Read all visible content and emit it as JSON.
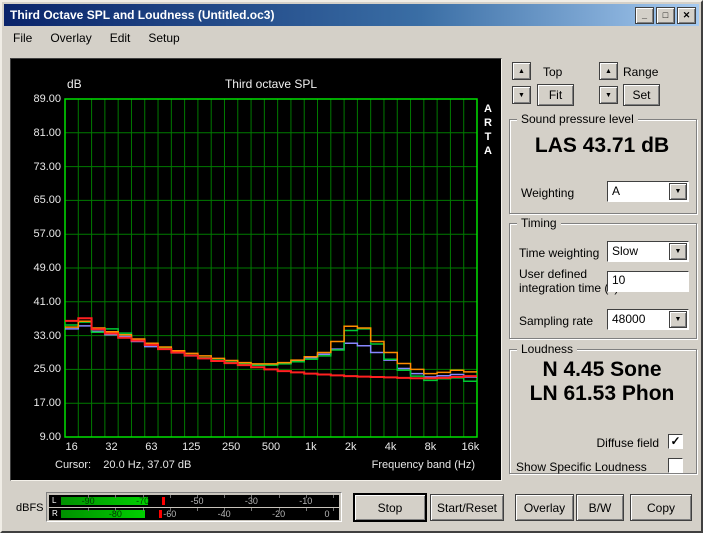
{
  "window": {
    "title": "Third Octave SPL and Loudness (Untitled.oc3)"
  },
  "icons": {
    "up": "▲",
    "down": "▼",
    "dropdown": "▼",
    "check": "✓",
    "minimize": "_",
    "maximize": "□",
    "close": "✕"
  },
  "menu": {
    "items": [
      "File",
      "Overlay",
      "Edit",
      "Setup"
    ]
  },
  "chart": {
    "cursor_text": "Cursor:    20.0 Hz, 37.07 dB",
    "brand": "ARTA"
  },
  "chart_data": {
    "type": "line",
    "title": "Third octave SPL",
    "ylabel": "dB",
    "xlabel": "Frequency band (Hz)",
    "ylim": [
      9,
      89
    ],
    "y_tick_step": 8,
    "background": "#000000",
    "grid_color": "#007a00",
    "border_color": "#00e000",
    "y_tick_labels": [
      "89.00",
      "81.00",
      "73.00",
      "65.00",
      "57.00",
      "49.00",
      "41.00",
      "33.00",
      "25.00",
      "17.00",
      "9.00"
    ],
    "x_tick_labels": [
      "16",
      "32",
      "63",
      "125",
      "250",
      "500",
      "1k",
      "2k",
      "4k",
      "8k",
      "16k"
    ],
    "x_bands_hz": [
      16,
      20,
      25,
      31.5,
      40,
      50,
      63,
      80,
      100,
      125,
      160,
      200,
      250,
      315,
      400,
      500,
      630,
      800,
      1000,
      1250,
      1600,
      2000,
      2500,
      3150,
      4000,
      5000,
      6300,
      8000,
      10000,
      12500,
      16000
    ],
    "series": [
      {
        "name": "blue",
        "color": "#8888ff",
        "width": 1.5,
        "values": [
          34.6,
          35.3,
          34.0,
          33.2,
          32.8,
          31.6,
          30.4,
          29.8,
          28.9,
          28.2,
          27.6,
          27.0,
          26.6,
          26.2,
          26.0,
          26.1,
          26.4,
          27.0,
          27.8,
          28.6,
          29.8,
          31.2,
          30.6,
          29.0,
          27.2,
          25.2,
          24.0,
          23.2,
          23.5,
          23.8,
          23.2
        ]
      },
      {
        "name": "green",
        "color": "#00c832",
        "width": 1.5,
        "values": [
          35.5,
          36.2,
          33.8,
          34.6,
          33.6,
          32.0,
          31.0,
          30.0,
          29.2,
          28.4,
          27.8,
          27.2,
          26.7,
          26.3,
          26.0,
          26.0,
          26.3,
          26.8,
          27.4,
          28.2,
          29.6,
          34.2,
          34.6,
          31.0,
          27.4,
          24.8,
          23.4,
          22.4,
          22.8,
          23.0,
          22.2
        ]
      },
      {
        "name": "orange",
        "color": "#ff8c00",
        "width": 1.5,
        "values": [
          35.0,
          36.4,
          34.8,
          33.9,
          33.2,
          32.2,
          31.2,
          30.3,
          29.4,
          28.8,
          28.2,
          27.6,
          27.1,
          26.6,
          26.3,
          26.3,
          26.6,
          27.2,
          28.0,
          29.0,
          31.6,
          35.2,
          34.8,
          31.6,
          29.0,
          26.4,
          25.0,
          24.0,
          24.3,
          24.8,
          24.4
        ]
      },
      {
        "name": "red",
        "color": "#ff2020",
        "width": 2,
        "values": [
          36.5,
          37.1,
          34.5,
          33.5,
          32.5,
          31.8,
          30.8,
          29.8,
          29.0,
          28.3,
          27.6,
          27.0,
          26.5,
          26.0,
          25.5,
          25.0,
          24.6,
          24.3,
          24.0,
          23.8,
          23.6,
          23.4,
          23.3,
          23.2,
          23.1,
          23.0,
          22.9,
          22.9,
          23.0,
          23.2,
          23.4
        ]
      }
    ]
  },
  "right_panel": {
    "top_label": "Top",
    "fit_button": "Fit",
    "range_label": "Range",
    "set_button": "Set",
    "spl": {
      "caption": "Sound pressure level",
      "value": "LAS 43.71 dB",
      "weighting_label": "Weighting",
      "weighting_value": "A"
    },
    "timing": {
      "caption": "Timing",
      "time_weighting_label": "Time weighting",
      "time_weighting_value": "Slow",
      "integration_label_line1": "User defined",
      "integration_label_line2": "integration time (s)",
      "integration_value": "10",
      "sampling_rate_label": "Sampling rate",
      "sampling_rate_value": "48000"
    },
    "loudness": {
      "caption": "Loudness",
      "sone_value": "N 4.45 Sone",
      "phon_value": "LN 61.53 Phon",
      "diffuse_field_label": "Diffuse field",
      "diffuse_checked": true,
      "show_specific_label": "Show Specific Loudness",
      "specific_checked": false
    }
  },
  "meter": {
    "label": "dBFS",
    "range_db": [
      -100,
      0
    ],
    "bar_color": "#00d000",
    "peak_color": "#ff0000",
    "rows": [
      {
        "channel": "L",
        "labels": [
          "-90",
          "-70",
          "-50",
          "-30",
          "-10"
        ],
        "label_positions_db": [
          -90,
          -70,
          -50,
          -30,
          -10
        ],
        "level_db": -68,
        "peak_db": -63
      },
      {
        "channel": "R",
        "labels": [
          "-80",
          "-60",
          "-40",
          "-20",
          "0"
        ],
        "label_positions_db": [
          -80,
          -60,
          -40,
          -20,
          0
        ],
        "level_db": -69,
        "peak_db": -64
      }
    ]
  },
  "buttons": {
    "stop": "Stop",
    "start_reset": "Start/Reset",
    "overlay": "Overlay",
    "bw": "B/W",
    "copy": "Copy"
  }
}
